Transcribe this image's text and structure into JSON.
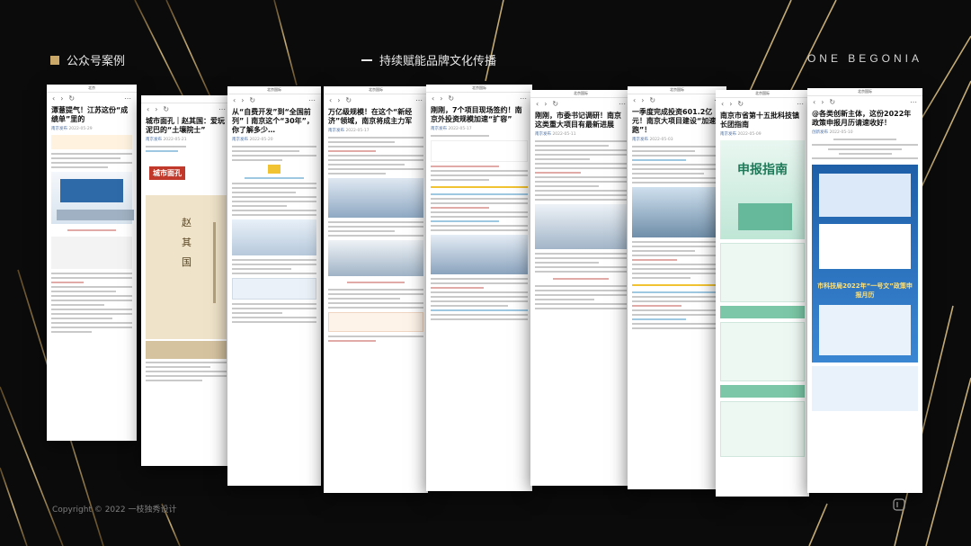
{
  "header": {
    "left_title": "公众号案例",
    "center_title": "持续赋能品牌文化传播",
    "right_brand": "ONE BEGONIA"
  },
  "footer": {
    "copyright": "Copyright © 2022  一枝独秀设计"
  },
  "cards": [
    {
      "title": "潭薏提气！江苏这份“成绩单”里的",
      "account": "南京发布",
      "date": "2022-05-29",
      "top": "北京"
    },
    {
      "title": "城市面孔｜赵其国：爱玩泥巴的“土壤院士”",
      "account": "南京发布",
      "date": "2022-05-21",
      "badge": "城市面孔",
      "book": "赵 其 国"
    },
    {
      "title": "从“自费开发”到“全国前列”丨南京这个“30年”，你了解多少…",
      "account": "南京发布",
      "date": "2022-05-20",
      "top": "北京国际"
    },
    {
      "title": "万亿级规模！在这个“新经济”领域，南京将成主力军",
      "account": "南京发布",
      "date": "2022-05-17",
      "top": "北京国际"
    },
    {
      "title": "刚刚，7个项目现场签约！南京外投资规模加速“扩容”",
      "account": "南京发布",
      "date": "2022-05-17",
      "top": "北京国际"
    },
    {
      "title": "刚刚，市委书记调研！南京这类重大项目有最新进展",
      "account": "南京发布",
      "date": "2022-05-11",
      "top": "北京国际"
    },
    {
      "title": "一季度完成投资601.2亿元！南京大项目建设“加速跑”！",
      "account": "南京发布",
      "date": "2022-05-03",
      "top": "北京国际"
    },
    {
      "title": "南京市省第十五批科技镇长团指南",
      "account": "南京发布",
      "date": "2022-05-09",
      "top": "北京国际",
      "banner": "申报指南"
    },
    {
      "title": "@各类创新主体，这份2022年政策申报月历请速收好！",
      "account": "创新发布",
      "date": "2022-05-10",
      "top": "北京国际",
      "promo": "市科技局2022年“一号文”政策申报月历"
    }
  ],
  "colors": {
    "accent_gold": "#c9a86a",
    "background": "#0b0b0b"
  }
}
